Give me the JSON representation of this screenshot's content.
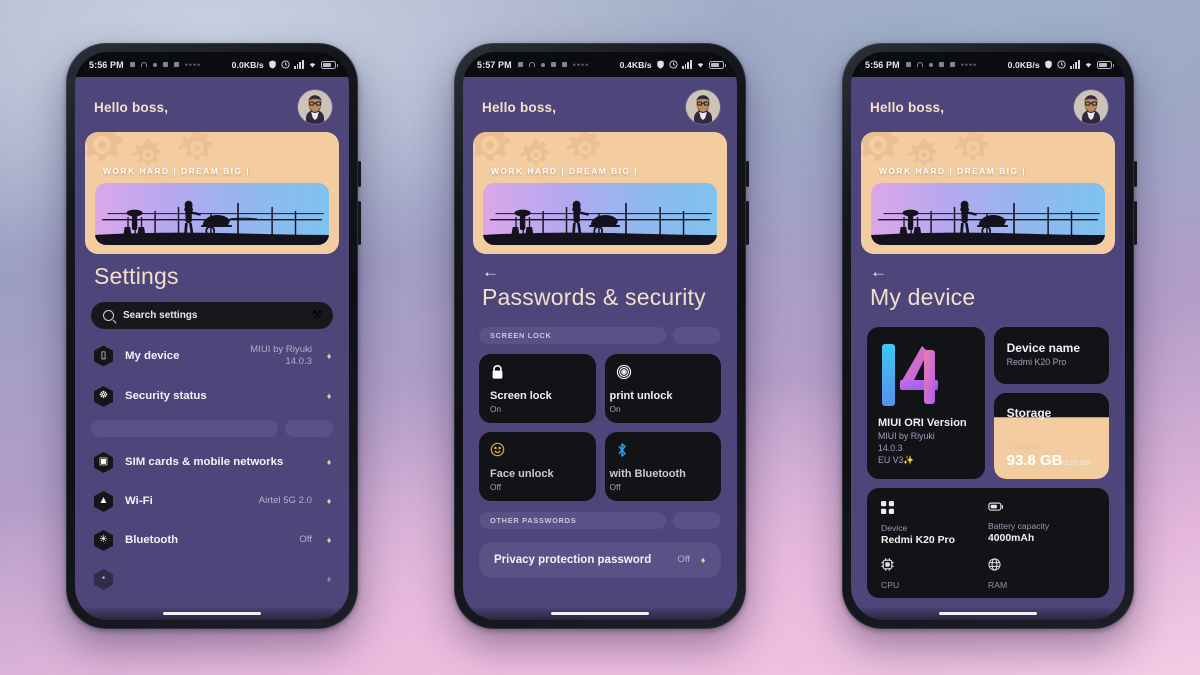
{
  "scene": {
    "background_accent": "#4e457a",
    "banner_color": "#f3cda0",
    "chevron_color": "#e9c79c"
  },
  "phones": [
    {
      "id": "phone-settings",
      "status": {
        "time": "5:56 PM",
        "network_speed": "0.0KB/s",
        "battery_label": ""
      },
      "greeting": "Hello boss,",
      "banner_text": "WORK HARD | DREAM BIG |",
      "title": "Settings",
      "search": {
        "placeholder": "Search settings",
        "left_icon": "search-icon",
        "right_icon": "hammer-and-pick-icon",
        "right_glyph": "⚒"
      },
      "rows": [
        {
          "icon": "phone-icon",
          "glyph": "▯",
          "label": "My device",
          "value": "MIUI by Riyuki 14.0.3",
          "chevron": "♦"
        },
        {
          "icon": "shield-icon",
          "glyph": "☸",
          "label": "Security status",
          "value": "",
          "chevron": "♦"
        }
      ],
      "rows2": [
        {
          "icon": "sim-card-icon",
          "glyph": "▣",
          "label": "SIM cards & mobile networks",
          "value": "",
          "chevron": "♦"
        },
        {
          "icon": "wifi-icon",
          "glyph": "▲",
          "label": "Wi-Fi",
          "value": "Airtel 5G 2.0",
          "chevron": "♦"
        },
        {
          "icon": "bluetooth-icon",
          "glyph": "✳",
          "label": "Bluetooth",
          "value": "Off",
          "chevron": "♦"
        }
      ]
    },
    {
      "id": "phone-passwords",
      "status": {
        "time": "5:57 PM",
        "network_speed": "0.4KB/s"
      },
      "greeting": "Hello boss,",
      "banner_text": "WORK HARD | DREAM BIG |",
      "back_glyph": "←",
      "title": "Passwords & security",
      "section_1": "SCREEN LOCK",
      "tiles": [
        {
          "icon": "lock-icon",
          "glyph": "🔒",
          "title": "Screen lock",
          "sub": "On"
        },
        {
          "icon": "fingerprint-icon",
          "glyph": "◎",
          "title": "print unlock",
          "sub": "On"
        },
        {
          "icon": "face-unlock-icon",
          "glyph": "🙂",
          "title": "Face unlock",
          "sub": "Off"
        },
        {
          "icon": "bluetooth-icon",
          "glyph": "✶",
          "title": "with Bluetooth",
          "sub": "Off"
        }
      ],
      "section_2": "OTHER PASSWORDS",
      "bottom_row": {
        "label": "Privacy protection password",
        "value": "Off",
        "chevron": "♦"
      }
    },
    {
      "id": "phone-my-device",
      "status": {
        "time": "5:56 PM",
        "network_speed": "0.0KB/s"
      },
      "greeting": "Hello boss,",
      "banner_text": "WORK HARD | DREAM BIG |",
      "back_glyph": "←",
      "title": "My device",
      "miui_card": {
        "logo": "14",
        "title": "MIUI ORI Version",
        "lines": "MIUI by Riyuki\n14.0.3\nEU V3✨"
      },
      "device_name_card": {
        "title": "Device name",
        "value": "Redmi K20 Pro"
      },
      "storage_card": {
        "title": "Storage",
        "occupied_label": "Occupied",
        "used": "93.8 GB",
        "total": "/128 GB"
      },
      "specs": [
        {
          "icon": "chip-icon",
          "glyph": "░",
          "key": "Device",
          "value": "Redmi K20 Pro"
        },
        {
          "icon": "battery-icon",
          "glyph": "▭",
          "key": "Battery capacity",
          "value": "4000mAh"
        },
        {
          "icon": "cpu-icon",
          "glyph": "▦",
          "key": "CPU",
          "value": ""
        },
        {
          "icon": "ram-icon",
          "glyph": "⊕",
          "key": "RAM",
          "value": ""
        }
      ]
    }
  ]
}
